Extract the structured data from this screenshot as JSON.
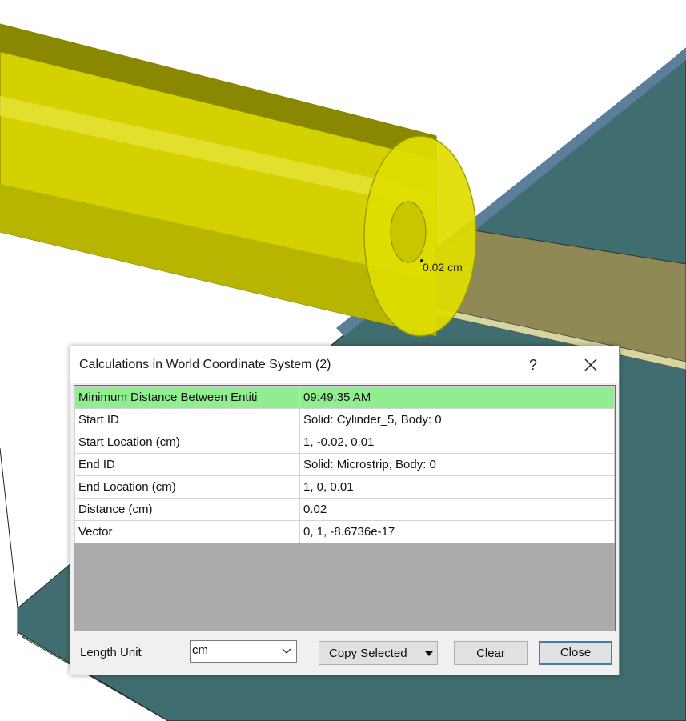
{
  "viewport": {
    "dimension_label": "0.02 cm",
    "colors": {
      "cylinder": "#d4d100",
      "board": "#3f6d70",
      "strip": "#8f8a55",
      "ground": "#7cc67c"
    }
  },
  "dialog": {
    "title": "Calculations in World Coordinate System (2)",
    "help_label": "?",
    "rows": [
      {
        "name": "Minimum Distance Between Entiti",
        "value": "09:49:35 AM"
      },
      {
        "name": "Start ID",
        "value": "Solid: Cylinder_5, Body: 0"
      },
      {
        "name": "Start Location (cm)",
        "value": "1, -0.02, 0.01"
      },
      {
        "name": "End ID",
        "value": "Solid: Microstrip, Body: 0"
      },
      {
        "name": "End Location (cm)",
        "value": "1, 0, 0.01"
      },
      {
        "name": "Distance (cm)",
        "value": "0.02"
      },
      {
        "name": "Vector",
        "value": "0, 1, -8.6736e-17"
      }
    ],
    "length_unit_label": "Length Unit",
    "length_unit_value": "cm",
    "copy_selected_label": "Copy Selected",
    "clear_label": "Clear",
    "close_label": "Close",
    "highlight_color": "#90ee90"
  }
}
